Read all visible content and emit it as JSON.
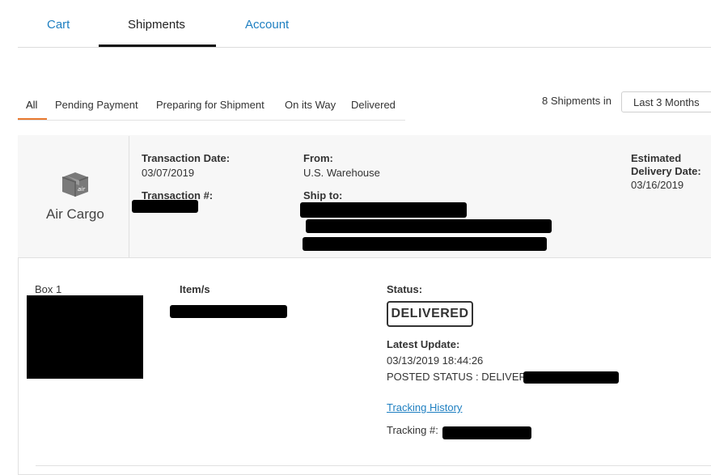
{
  "tabs": {
    "cart": "Cart",
    "shipments": "Shipments",
    "account": "Account"
  },
  "filters": {
    "all": "All",
    "pending_payment": "Pending Payment",
    "preparing": "Preparing for Shipment",
    "on_its_way": "On its Way",
    "delivered": "Delivered"
  },
  "summary": {
    "count_text": "8 Shipments in",
    "range_value": "Last 3 Months"
  },
  "shipment": {
    "carrier": "Air Cargo",
    "transaction_date_label": "Transaction Date:",
    "transaction_date": "03/07/2019",
    "transaction_no_label": "Transaction #:",
    "from_label": "From:",
    "from_value": "U.S. Warehouse",
    "ship_to_label": "Ship to:",
    "eta_label_line1": "Estimated",
    "eta_label_line2": "Delivery Date:",
    "eta_value": "03/16/2019",
    "box_label": "Box 1",
    "items_label": "Item/s",
    "status_label": "Status:",
    "status_value": "DELIVERED",
    "latest_update_label": "Latest Update:",
    "latest_update_time": "03/13/2019 18:44:26",
    "posted_status": "POSTED STATUS : DELIVERED",
    "tracking_history": "Tracking History",
    "tracking_label": "Tracking #:"
  },
  "colors": {
    "link": "#1e7fc1",
    "active_filter_underline": "#e8792f",
    "header_bg": "#f7f7f7"
  },
  "icons": {
    "carrier": "air-cargo-box-icon"
  }
}
